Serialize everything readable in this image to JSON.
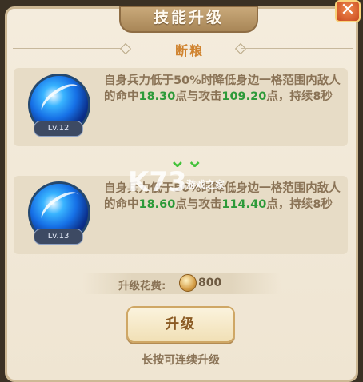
{
  "window": {
    "title": "技能升级",
    "close_icon": "✕"
  },
  "skill": {
    "name": "断粮"
  },
  "current": {
    "level": "Lv.12",
    "desc_prefix": "自身兵力低于50%时降低身边一格范围内敌人的命中",
    "value_1": "18.30",
    "mid_text": "点与攻击",
    "value_2": "109.20",
    "suffix": "点，持续8秒"
  },
  "next": {
    "level": "Lv.13",
    "desc_prefix": "自身兵力低于50%时降低身边一格范围内敌人的命中",
    "value_1": "18.60",
    "mid_text": "点与攻击",
    "value_2": "114.40",
    "suffix": "点，持续8秒"
  },
  "arrow_icon": "⌄⌄",
  "watermark": {
    "main": "K73",
    "sub": "游戏之家"
  },
  "cost": {
    "label": "升级花费:",
    "value": "800"
  },
  "upgrade_button": "升级",
  "hint": "长按可连续升级",
  "colors": {
    "accent": "#d0832f",
    "highlight_number": "#2d9a39",
    "text": "#8a7356"
  }
}
